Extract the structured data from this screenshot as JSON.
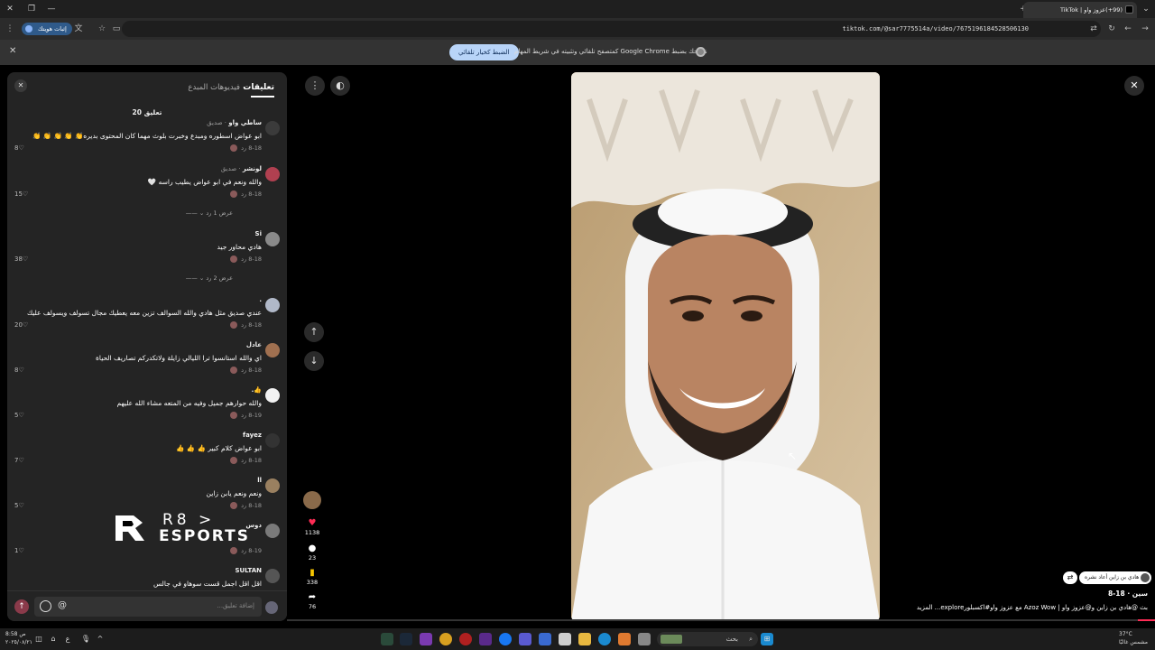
{
  "browser": {
    "tab_title": "(99+)عزوز واو | TikTok",
    "url": "tiktok.com/@sar7775514a/video/7675196184528506130",
    "verify_label": "إثبات هويتك",
    "info_message": "ننصحك بضبط Google Chrome كمتصفح تلقائي وتثبيته في شريط المهام",
    "info_cta": "الضبط كخيار تلقائي"
  },
  "panel": {
    "tab_comments": "تعليقات",
    "tab_creator_videos": "فيديوهات المبدع",
    "comment_count": "20 تعليق",
    "reply_label": "رد",
    "input_placeholder": "إضافة تعليق...",
    "at_symbol": "@",
    "comments": [
      {
        "user": "ساطي واو",
        "tag": " · صديق",
        "text": "ابو عواض اسطوره ومبدع وخبرت بلوث مهما كان المحتوى بديره👏 👏 👏 👏 👏",
        "date": "8-18",
        "likes": "8",
        "avatar": "#3b3b3b"
      },
      {
        "user": "لونشر",
        "tag": " · صديق",
        "text": "والله ونعم في ابو عواض يطيب راسه 🤍",
        "date": "8-18",
        "likes": "15",
        "avatar": "#b04050"
      },
      {
        "user": "Si",
        "tag": "",
        "text": "هادي محاور جيد",
        "date": "8-18",
        "likes": "38",
        "avatar": "#8a8a8a"
      },
      {
        "user": ".",
        "tag": "",
        "text": "عندي صديق مثل هادي والله السوالف تزين معه يعطيك مجال تسولف ويسولف عليك",
        "date": "8-18",
        "likes": "20",
        "avatar": "#b0b8c8"
      },
      {
        "user": "عادل",
        "tag": "",
        "text": "اي والله استانسوا ترا الليالي زايلة ولاتكدركم تصاريف الحياة",
        "date": "8-18",
        "likes": "8",
        "avatar": "#a07050"
      },
      {
        "user": "👍.",
        "tag": "",
        "text": "والله حوارهم جميل وفيه من المتعه مشاء الله عليهم",
        "date": "8-19",
        "likes": "5",
        "avatar": "#f2f2f2"
      },
      {
        "user": "fayez",
        "tag": "",
        "text": "ابو عواض كلام كبير 👍 👍 👍",
        "date": "8-18",
        "likes": "7",
        "avatar": "#333333"
      },
      {
        "user": "ll",
        "tag": "",
        "text": "ونعم ونعم يابن زاين",
        "date": "8-18",
        "likes": "5",
        "avatar": "#9a8060"
      },
      {
        "user": "دوس",
        "tag": "",
        "text": "",
        "date": "8-19",
        "likes": "1",
        "avatar": "#7a7a7a"
      },
      {
        "user": "SULTAN",
        "tag": "",
        "text": "اقل اقل اجمل قست سوهاو في جالس",
        "date": "",
        "likes": "",
        "avatar": "#555555"
      }
    ],
    "replies_a": "عرض 1 رد",
    "replies_b": "عرض 2 رد"
  },
  "watermark": {
    "line1": "R8 >",
    "line2": "ESPORTS"
  },
  "rail": {
    "likes": "1138",
    "comments": "23",
    "saves": "338",
    "shares": "76"
  },
  "video": {
    "repost_text": "هادي بن زاين أعاد نشره",
    "author": "سين · 18-8",
    "description": "بث @هادي بن زاين و@عزوز واو | Azoz Wow مع عزوز واو#اكسبلورexplore...  المزيد",
    "progress": 0.02
  },
  "taskbar": {
    "search": "بحث",
    "time": "8:58 ص",
    "date": "٢٠٢٥/٠٨/٢١",
    "temp": "37°C",
    "weather": "مشمس غالبًا"
  },
  "colors": {
    "accent": "#fe2c55",
    "panel": "#242424",
    "banner_btn": "#b8d4f8"
  }
}
